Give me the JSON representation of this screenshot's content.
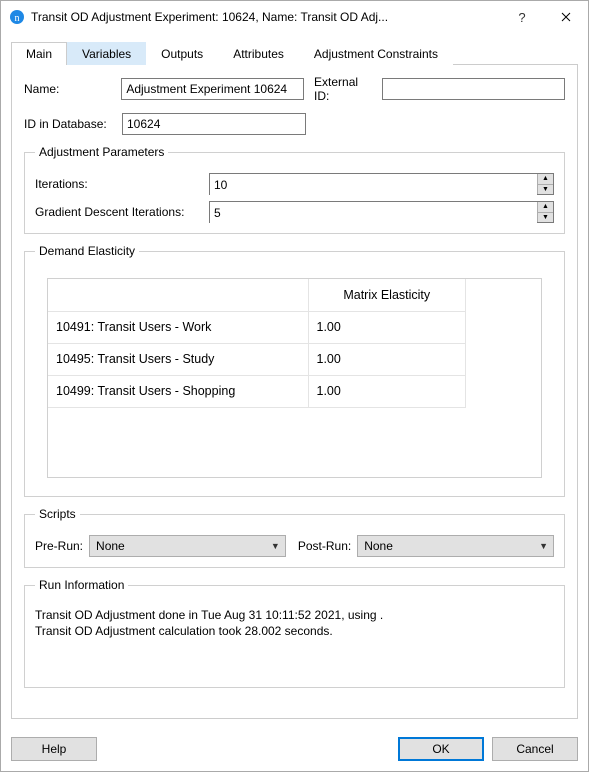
{
  "title": "Transit OD Adjustment Experiment: 10624, Name: Transit OD Adj...",
  "tabs": {
    "main": "Main",
    "variables": "Variables",
    "outputs": "Outputs",
    "attributes": "Attributes",
    "constraints": "Adjustment Constraints"
  },
  "form": {
    "name_label": "Name:",
    "name_value": "Adjustment Experiment 10624",
    "external_id_label": "External ID:",
    "external_id_value": "",
    "db_id_label": "ID in Database:",
    "db_id_value": "10624"
  },
  "adj_params": {
    "legend": "Adjustment Parameters",
    "iterations_label": "Iterations:",
    "iterations_value": "10",
    "gdi_label": "Gradient Descent Iterations:",
    "gdi_value": "5"
  },
  "elasticity": {
    "legend": "Demand Elasticity",
    "header_matrix": "Matrix Elasticity",
    "rows": [
      {
        "label": "10491: Transit Users - Work",
        "value": "1.00"
      },
      {
        "label": "10495: Transit Users - Study",
        "value": "1.00"
      },
      {
        "label": "10499: Transit Users - Shopping",
        "value": "1.00"
      }
    ]
  },
  "scripts": {
    "legend": "Scripts",
    "pre_label": "Pre-Run:",
    "pre_value": "None",
    "post_label": "Post-Run:",
    "post_value": "None"
  },
  "run_info": {
    "legend": "Run Information",
    "line1": "Transit OD Adjustment done in Tue Aug 31 10:11:52 2021, using .",
    "line2": "Transit OD Adjustment calculation took 28.002 seconds."
  },
  "buttons": {
    "help": "Help",
    "ok": "OK",
    "cancel": "Cancel"
  }
}
